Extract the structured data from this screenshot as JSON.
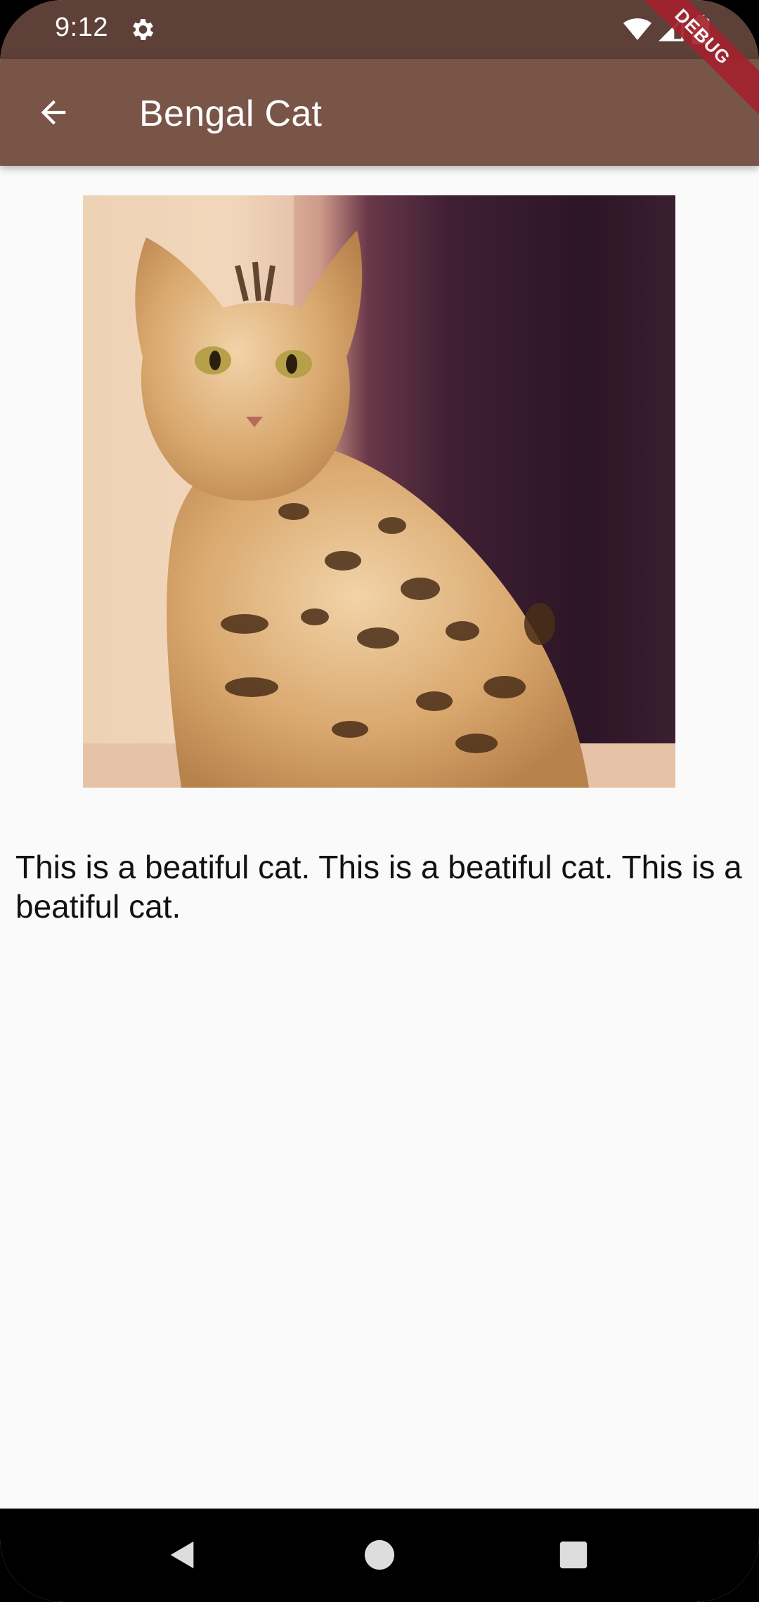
{
  "status_bar": {
    "time": "9:12",
    "icons": [
      "gear-icon",
      "wifi-icon",
      "signal-icon",
      "battery-icon"
    ]
  },
  "debug_banner": "DEBUG",
  "app_bar": {
    "title": "Bengal Cat",
    "back_icon": "arrow-back-icon",
    "color": "#795548",
    "status_color": "#5d4037"
  },
  "content": {
    "image_alt": "bengal-cat-photo",
    "description": "This is a beatiful cat. This is a beatiful cat. This is a beatiful cat."
  },
  "nav_bar": {
    "buttons": [
      "back-triangle-icon",
      "home-circle-icon",
      "recents-square-icon"
    ]
  }
}
